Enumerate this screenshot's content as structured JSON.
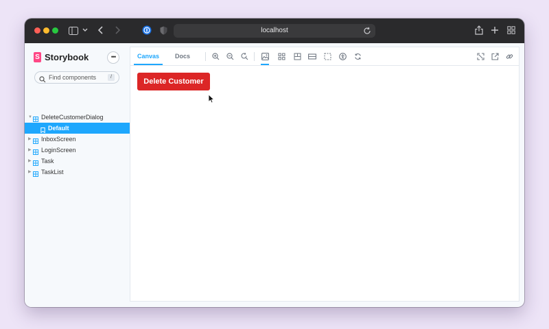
{
  "browser": {
    "url": "localhost"
  },
  "sidebar": {
    "brand": "Storybook",
    "brand_initial": "S",
    "menu_glyph": "•••",
    "search_placeholder": "Find components",
    "search_shortcut": "/",
    "tree": [
      {
        "label": "DeleteCustomerDialog",
        "type": "component",
        "expanded": true
      },
      {
        "label": "Default",
        "type": "story",
        "selected": true
      },
      {
        "label": "InboxScreen",
        "type": "component"
      },
      {
        "label": "LoginScreen",
        "type": "component"
      },
      {
        "label": "Task",
        "type": "component"
      },
      {
        "label": "TaskList",
        "type": "component"
      }
    ]
  },
  "toolbar": {
    "tabs": [
      {
        "label": "Canvas",
        "active": true
      },
      {
        "label": "Docs",
        "active": false
      }
    ],
    "tools": [
      "zoom-in-icon",
      "zoom-out-icon",
      "zoom-reset-icon",
      "background-icon",
      "grid-icon",
      "measure-icon",
      "viewport-icon",
      "outline-icon",
      "accessibility-icon",
      "remount-icon"
    ],
    "right_tools": [
      "fullscreen-icon",
      "open-new-tab-icon",
      "copy-link-icon"
    ]
  },
  "canvas": {
    "button_label": "Delete Customer"
  },
  "colors": {
    "accent": "#1ea7fd",
    "danger": "#dc2626",
    "brand": "#ff4785"
  }
}
